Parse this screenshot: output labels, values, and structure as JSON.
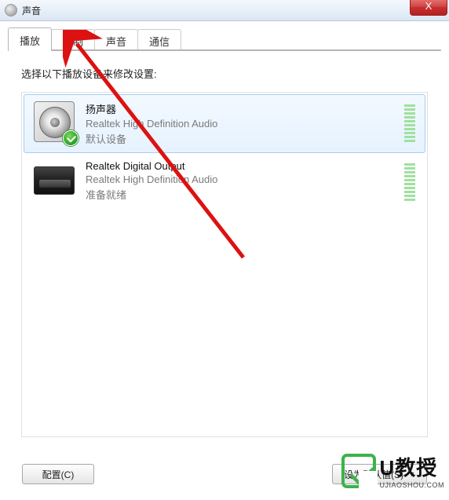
{
  "window": {
    "title": "声音",
    "close_label": "X"
  },
  "tabs": [
    {
      "label": "播放"
    },
    {
      "label": "录制"
    },
    {
      "label": "声音"
    },
    {
      "label": "通信"
    }
  ],
  "instruction": "选择以下播放设备来修改设置:",
  "devices": [
    {
      "name": "扬声器",
      "subtitle": "Realtek High Definition Audio",
      "status": "默认设备",
      "selected": true,
      "default": true,
      "icon": "speaker"
    },
    {
      "name": "Realtek Digital Output",
      "subtitle": "Realtek High Definition Audio",
      "status": "准备就绪",
      "selected": false,
      "default": false,
      "icon": "digital"
    }
  ],
  "buttons": {
    "configure": "配置(C)",
    "set_default": "设为默认值(S)"
  },
  "watermark": {
    "main": "U教授",
    "sub": "UJIAOSHOU.COM"
  }
}
